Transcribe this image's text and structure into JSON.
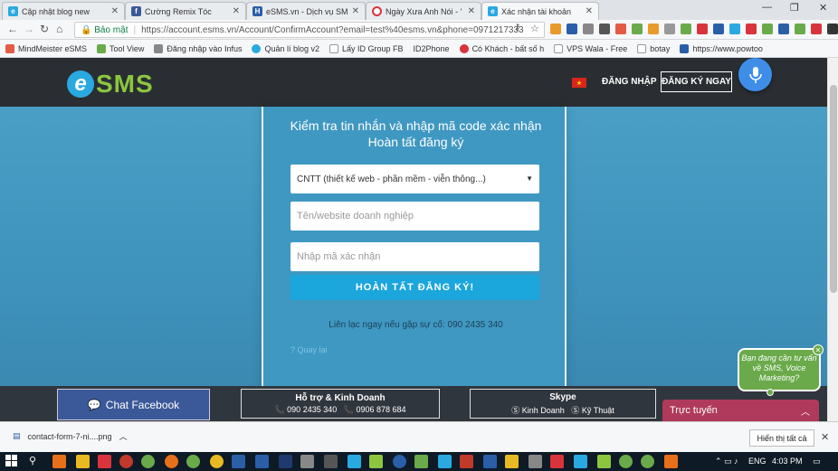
{
  "browser": {
    "tabs": [
      {
        "label": "Cập nhật blog new",
        "icon": "esms-icon",
        "color": "#2aa9e0",
        "active": false
      },
      {
        "label": "Cường Remix Tóc",
        "icon": "facebook-icon",
        "color": "#3b5998",
        "active": false
      },
      {
        "label": "eSMS.vn - Dịch vụ SMS c",
        "icon": "hostinger-icon",
        "color": "#2a5fa8",
        "active": false
      },
      {
        "label": "Ngày Xưa Anh Nói - '",
        "icon": "youtube-icon",
        "color": "#d9343b",
        "active": false
      },
      {
        "label": "Xác nhận tài khoản",
        "icon": "esms-icon",
        "color": "#2aa9e0",
        "active": true
      }
    ],
    "secure_label": "Bảo mật",
    "url": "https://account.esms.vn/Account/ConfirmAccount?email=test%40esms.vn&phone=0971217333",
    "bookmarks": [
      {
        "label": "MindMeister eSMS",
        "color": "#e45b46"
      },
      {
        "label": "Tool View",
        "color": "#6aaa4a"
      },
      {
        "label": "Đăng nhập vào Infus",
        "color": "#888"
      },
      {
        "label": "Quản lí blog v2",
        "color": "#2aa9e0"
      },
      {
        "label": "Lấy ID Group FB",
        "color": "#999"
      },
      {
        "label": "ID2Phone",
        "color": "#fff"
      },
      {
        "label": "Có Khách - bất số h",
        "color": "#d9343b"
      },
      {
        "label": "VPS Wala - Free",
        "color": "#999"
      },
      {
        "label": "botay",
        "color": "#999"
      },
      {
        "label": "https://www.powtoo",
        "color": "#2a5fa8"
      }
    ]
  },
  "header": {
    "logo_e": "e",
    "logo_text": "SMS",
    "flag": "★",
    "login_label": "ĐĂNG NHẬP",
    "register_label": "ĐĂNG KÝ NGAY"
  },
  "form": {
    "title_line1": "Kiểm tra tin nhắn và nhập mã code xác nhận",
    "title_line2": "Hoàn tất đăng ký",
    "industry_value": "CNTT (thiết kế web - phần mềm - viễn thông...)",
    "company_placeholder": "Tên/website doanh nghiệp",
    "code_placeholder": "Nhập mã xác nhận",
    "submit_label": "HOÀN TẤT ĐĂNG KÝ!",
    "contact_text": "Liên lạc ngay nếu gặp sự cố: 090 2435 340",
    "back_link": "? Quay lại"
  },
  "footer": {
    "chat_fb": "Chat Facebook",
    "support_title": "Hỗ trợ & Kinh Doanh",
    "support_phone1": "090 2435 340",
    "support_phone2": "0906 878 684",
    "skype_title": "Skype",
    "skype_sales": "Kinh Doanh",
    "skype_tech": "Kỹ Thuật",
    "online_label": "Trực tuyến",
    "bubble_text": "Bạn đang cần tư vấn về SMS, Voice Marketing?"
  },
  "download": {
    "file": "contact-form-7-ni....png",
    "show_all": "Hiển thị tất cả"
  },
  "taskbar": {
    "lang": "ENG",
    "time": "4:03 PM"
  }
}
